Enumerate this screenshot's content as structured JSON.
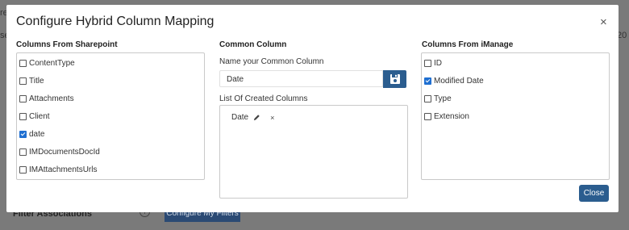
{
  "background": {
    "filter_label": "Filter Associations",
    "info_icon": "i",
    "configure_button": "Configure My Filters",
    "edge_left_1": "re",
    "edge_left_2": "se",
    "edge_right": "/20"
  },
  "modal": {
    "title": "Configure Hybrid Column Mapping",
    "close_icon": "×",
    "left": {
      "heading": "Columns From Sharepoint",
      "items": [
        {
          "label": "ContentType",
          "checked": false
        },
        {
          "label": "Title",
          "checked": false
        },
        {
          "label": "Attachments",
          "checked": false
        },
        {
          "label": "Client",
          "checked": false
        },
        {
          "label": "date",
          "checked": true
        },
        {
          "label": "IMDocumentsDocId",
          "checked": false
        },
        {
          "label": "IMAttachmentsUrls",
          "checked": false
        }
      ]
    },
    "middle": {
      "heading": "Common Column",
      "name_label": "Name your Common Column",
      "name_value": "Date",
      "list_label": "List Of Created Columns",
      "created": [
        {
          "label": "Date",
          "edit_icon": "pencil-icon",
          "remove_icon": "×"
        }
      ]
    },
    "right": {
      "heading": "Columns From iManage",
      "items": [
        {
          "label": "ID",
          "checked": false
        },
        {
          "label": "Modified Date",
          "checked": true
        },
        {
          "label": "Type",
          "checked": false
        },
        {
          "label": "Extension",
          "checked": false
        }
      ]
    },
    "close_label": "Close",
    "accent": "#2b5d8f"
  }
}
